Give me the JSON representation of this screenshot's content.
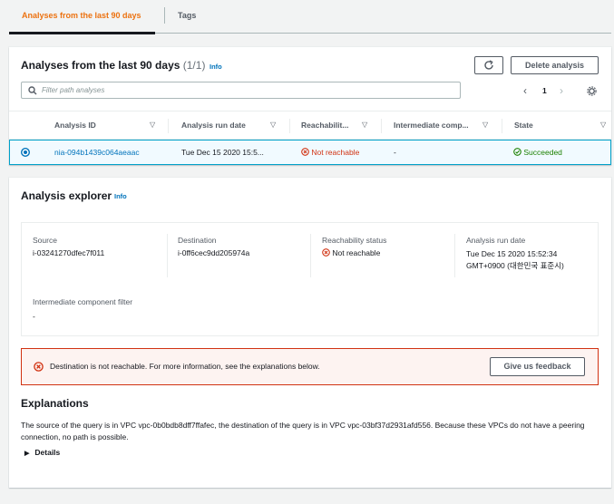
{
  "tabs": [
    {
      "label": "Analyses from the last 90 days",
      "active": true
    },
    {
      "label": "Tags",
      "active": false
    }
  ],
  "analyses": {
    "title": "Analyses from the last 90 days",
    "count": "(1/1)",
    "info": "Info",
    "delete_label": "Delete analysis",
    "search_placeholder": "Filter path analyses",
    "page": "1",
    "columns": [
      "Analysis ID",
      "Analysis run date",
      "Reachabilit...",
      "Intermediate comp...",
      "State"
    ],
    "rows": [
      {
        "id": "nia-094b1439c064aeaac",
        "run_date": "Tue Dec 15 2020 15:5...",
        "reachability": "Not reachable",
        "intermediate": "-",
        "state": "Succeeded"
      }
    ]
  },
  "explorer": {
    "title": "Analysis explorer",
    "info": "Info",
    "source_label": "Source",
    "source_value": "i-03241270dfec7f011",
    "destination_label": "Destination",
    "destination_value": "i-0ff6cec9dd205974a",
    "reachability_label": "Reachability status",
    "reachability_value": "Not reachable",
    "run_date_label": "Analysis run date",
    "run_date_line1": "Tue Dec 15 2020 15:52:34",
    "run_date_line2": "GMT+0900 (대한민국 표준시)",
    "filter_label": "Intermediate component filter",
    "filter_value": "-",
    "alert_text": "Destination is not reachable. For more information, see the explanations below.",
    "feedback_label": "Give us feedback",
    "explanations_title": "Explanations",
    "explanation_text": "The source of the query is in VPC vpc-0b0bdb8dff7ffafec, the destination of the query is in VPC vpc-03bf37d2931afd556. Because these VPCs do not have a peering connection, no path is possible.",
    "details_label": "Details"
  },
  "colors": {
    "accent": "#ec7211",
    "link": "#0073bb",
    "error": "#d13212",
    "success": "#1d8102",
    "selected_row": "#f1faff"
  },
  "icons": [
    "search-icon",
    "refresh-icon",
    "chevron-left-icon",
    "chevron-right-icon",
    "settings-icon",
    "sort-caret-icon",
    "radio-selected-icon",
    "error-circle-icon",
    "success-circle-icon",
    "caret-right-icon"
  ]
}
